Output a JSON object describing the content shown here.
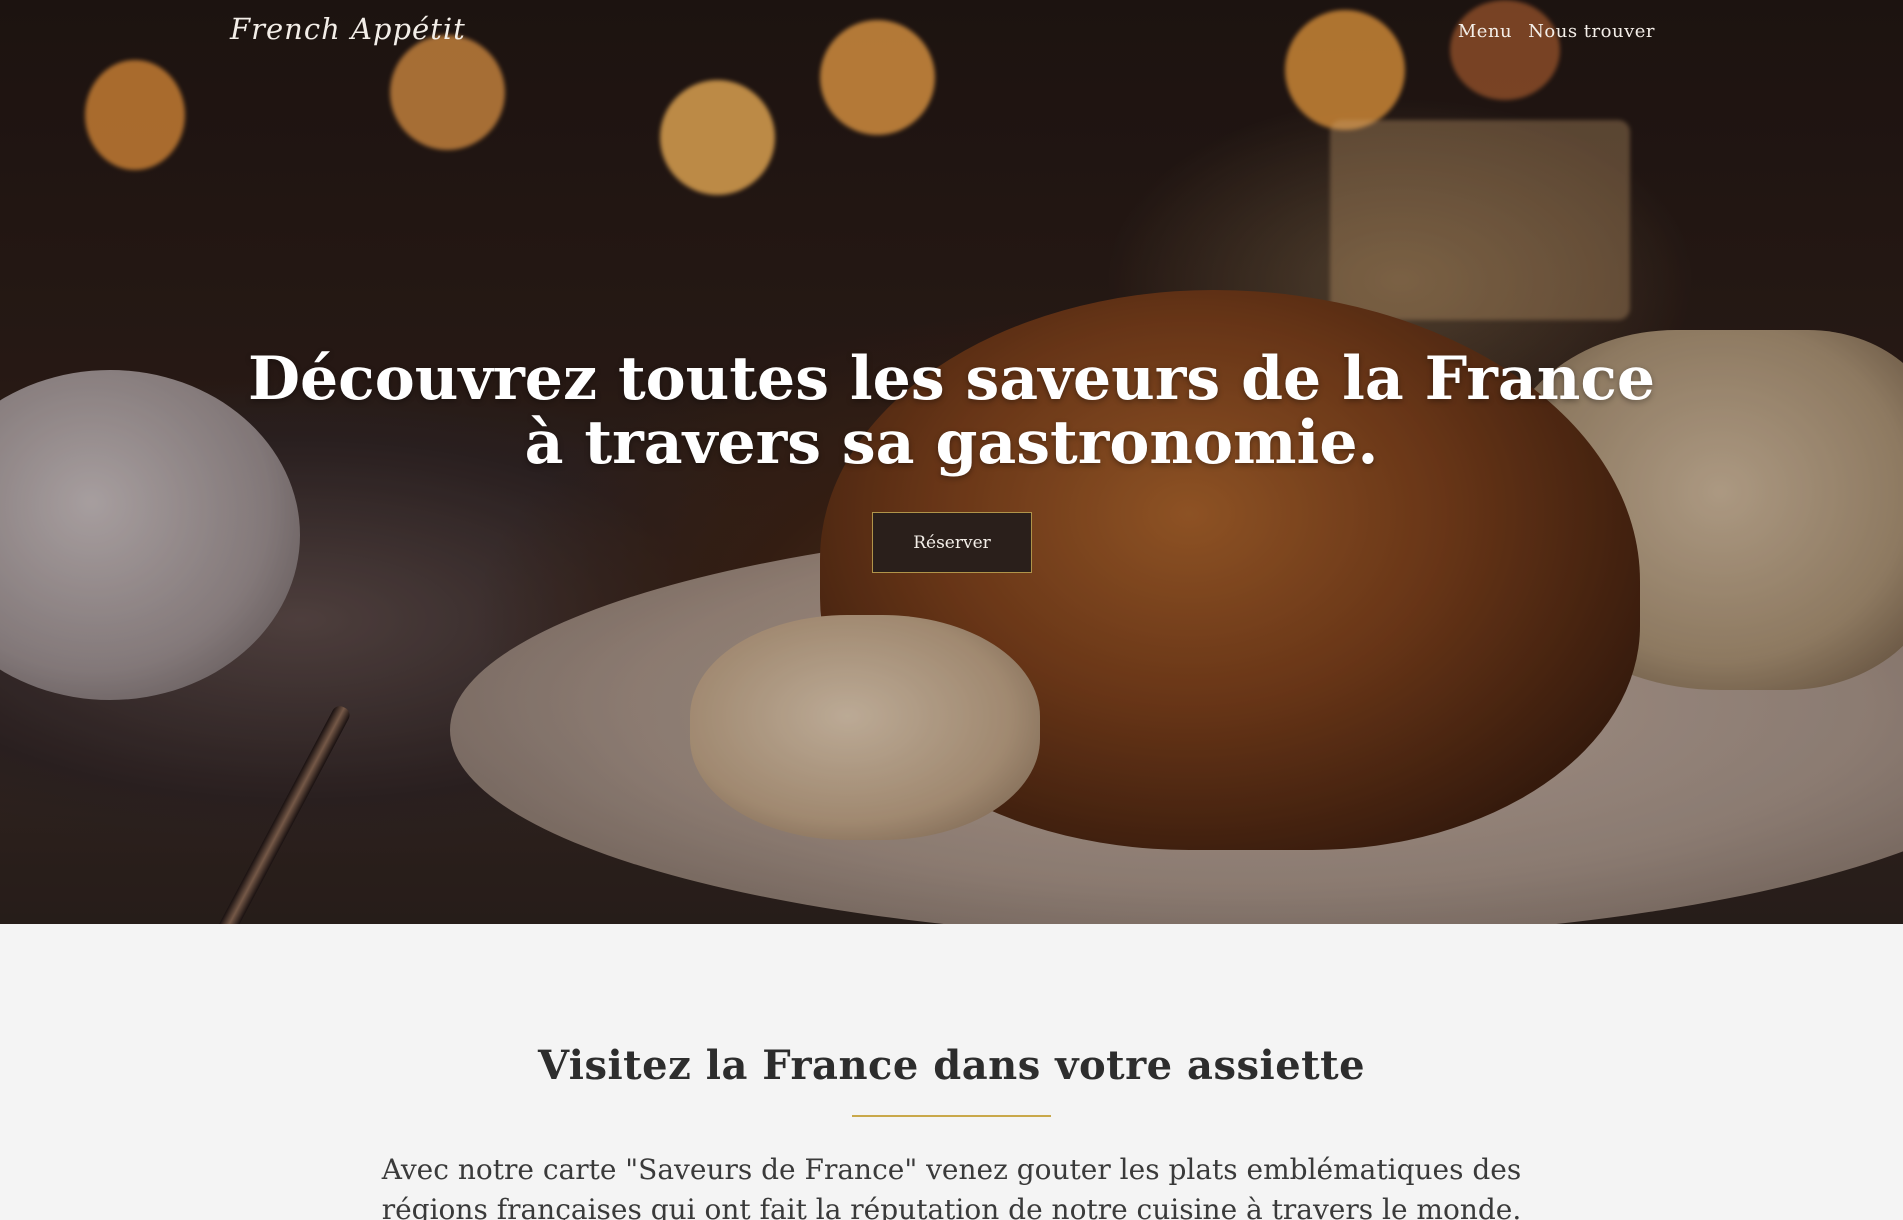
{
  "brand": {
    "logo_text": "French Appétit"
  },
  "nav": {
    "items": [
      {
        "label": "Menu"
      },
      {
        "label": "Nous trouver"
      }
    ]
  },
  "hero": {
    "title": "Découvrez toutes les saveurs de la France à travers sa gastronomie.",
    "cta_label": "Réserver"
  },
  "intro": {
    "title": "Visitez la France dans votre assiette",
    "text": "Avec notre carte \"Saveurs de France\" venez gouter les plats emblématiques des régions françaises qui ont fait la réputation de notre cuisine à travers le monde."
  },
  "colors": {
    "accent_gold": "#c9a84a",
    "button_bg": "#2a1f1b",
    "section_bg": "#f4f4f4"
  }
}
